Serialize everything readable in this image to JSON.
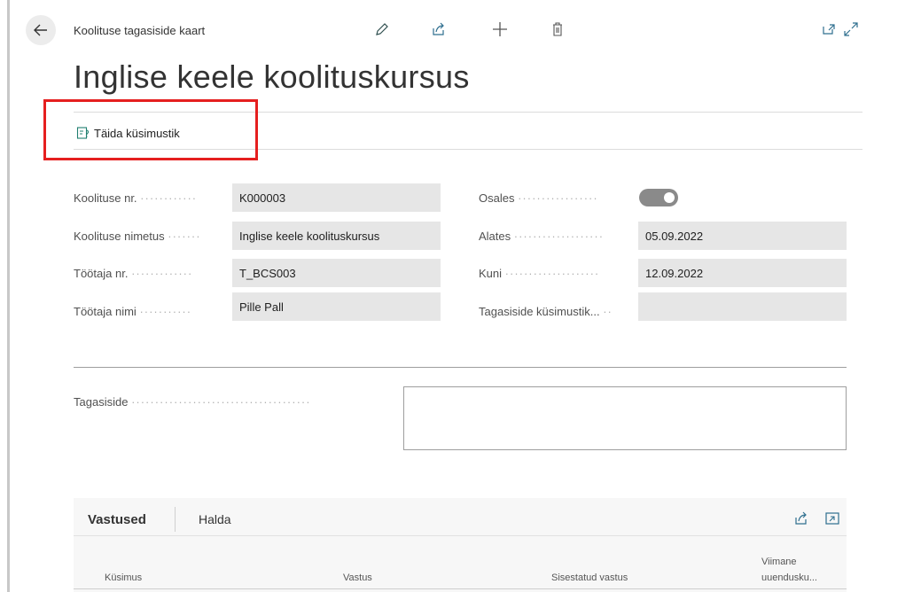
{
  "header": {
    "breadcrumb": "Koolituse tagasiside kaart",
    "title": "Inglise keele koolituskursus"
  },
  "actions": {
    "fill_questionnaire": "Täida küsimustik"
  },
  "fields": {
    "training_no_label": "Koolituse nr.",
    "training_no_value": "K000003",
    "training_name_label": "Koolituse nimetus",
    "training_name_value": "Inglise keele koolituskursus",
    "employee_no_label": "Töötaja nr.",
    "employee_no_value": "T_BCS003",
    "employee_name_label": "Töötaja nimi",
    "employee_name_value": "Pille Pall",
    "participated_label": "Osales",
    "participated_value": true,
    "from_label": "Alates",
    "from_value": "05.09.2022",
    "to_label": "Kuni",
    "to_value": "12.09.2022",
    "questionnaire_label": "Tagasiside küsimustik...",
    "questionnaire_value": "",
    "feedback_label": "Tagasiside",
    "feedback_value": ""
  },
  "answers": {
    "tab_answers": "Vastused",
    "tab_manage": "Halda",
    "columns": [
      "Küsimus",
      "Vastus",
      "Sisestatud vastus",
      "Viimane",
      "uuendusku..."
    ]
  },
  "icons": {
    "back": "back-arrow-icon",
    "edit": "pencil-icon",
    "share": "share-icon",
    "add": "plus-icon",
    "delete": "trash-icon",
    "open_new": "open-new-window-icon",
    "expand": "expand-icon"
  },
  "colors": {
    "highlight": "#e51f1f",
    "field_bg": "#e6e6e6",
    "toggle_on": "#8a8a8a"
  }
}
